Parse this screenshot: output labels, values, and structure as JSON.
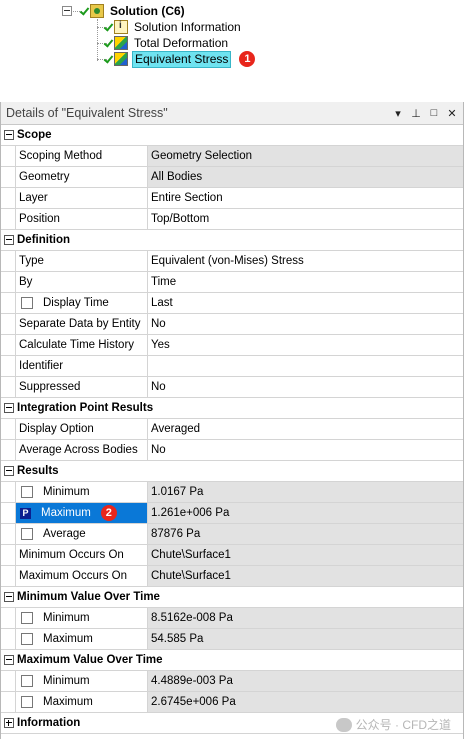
{
  "tree": {
    "root_label": "Solution (C6)",
    "children": [
      {
        "label": "Solution Information"
      },
      {
        "label": "Total Deformation"
      },
      {
        "label": "Equivalent Stress"
      }
    ],
    "badge1": "1"
  },
  "panel": {
    "title": "Details of \"Equivalent Stress\"",
    "buttons": {
      "menu": "▾",
      "pin": "⊥",
      "maximize": "□",
      "close": "✕"
    }
  },
  "sections": {
    "scope": {
      "label": "Scope",
      "rows": [
        {
          "name": "Scoping Method",
          "value": "Geometry Selection"
        },
        {
          "name": "Geometry",
          "value": "All Bodies"
        },
        {
          "name": "Layer",
          "value": "Entire Section"
        },
        {
          "name": "Position",
          "value": "Top/Bottom"
        }
      ]
    },
    "definition": {
      "label": "Definition",
      "rows": [
        {
          "name": "Type",
          "value": "Equivalent (von-Mises) Stress"
        },
        {
          "name": "By",
          "value": "Time"
        },
        {
          "name": "Display Time",
          "value": "Last"
        },
        {
          "name": "Separate Data by Entity",
          "value": "No"
        },
        {
          "name": "Calculate Time History",
          "value": "Yes"
        },
        {
          "name": "Identifier",
          "value": ""
        },
        {
          "name": "Suppressed",
          "value": "No"
        }
      ]
    },
    "integration": {
      "label": "Integration Point Results",
      "rows": [
        {
          "name": "Display Option",
          "value": "Averaged"
        },
        {
          "name": "Average Across Bodies",
          "value": "No"
        }
      ]
    },
    "results": {
      "label": "Results",
      "rows": [
        {
          "name": "Minimum",
          "value": "1.0167 Pa"
        },
        {
          "name": "Maximum",
          "value": "1.261e+006 Pa"
        },
        {
          "name": "Average",
          "value": "87876 Pa"
        },
        {
          "name": "Minimum Occurs On",
          "value": "Chute\\Surface1"
        },
        {
          "name": "Maximum Occurs On",
          "value": "Chute\\Surface1"
        }
      ],
      "param_box": "P",
      "badge2": "2"
    },
    "min_over_time": {
      "label": "Minimum Value Over Time",
      "rows": [
        {
          "name": "Minimum",
          "value": "8.5162e-008 Pa"
        },
        {
          "name": "Maximum",
          "value": "54.585 Pa"
        }
      ]
    },
    "max_over_time": {
      "label": "Maximum Value Over Time",
      "rows": [
        {
          "name": "Minimum",
          "value": "4.4889e-003 Pa"
        },
        {
          "name": "Maximum",
          "value": "2.6745e+006 Pa"
        }
      ]
    },
    "information": {
      "label": "Information"
    }
  },
  "watermark": "公众号 · CFD之道",
  "colors": {
    "selection_blue": "#0a78d7",
    "tree_highlight": "#6fe3f0",
    "badge_red": "#e8261c",
    "param_navy": "#0b1f8f"
  }
}
